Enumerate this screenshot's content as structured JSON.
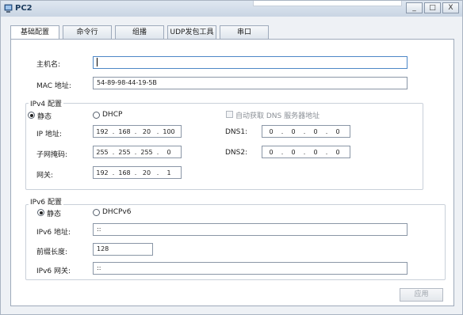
{
  "window": {
    "title": "PC2",
    "buttons": {
      "minimize": "_",
      "maximize": "□",
      "close": "X"
    }
  },
  "tabs": [
    {
      "label": "基础配置",
      "active": true
    },
    {
      "label": "命令行",
      "active": false
    },
    {
      "label": "组播",
      "active": false
    },
    {
      "label": "UDP发包工具",
      "active": false
    },
    {
      "label": "串口",
      "active": false
    }
  ],
  "basic": {
    "hostname_label": "主机名:",
    "hostname_value": "",
    "mac_label": "MAC 地址:",
    "mac_value": "54-89-98-44-19-5B"
  },
  "ipv4": {
    "group_title": "IPv4 配置",
    "static_label": "静态",
    "static_selected": true,
    "dhcp_label": "DHCP",
    "auto_dns_label": "自动获取 DNS 服务器地址",
    "ip_label": "IP 地址:",
    "ip": [
      "192",
      "168",
      "20",
      "100"
    ],
    "mask_label": "子网掩码:",
    "mask": [
      "255",
      "255",
      "255",
      "0"
    ],
    "gateway_label": "网关:",
    "gateway": [
      "192",
      "168",
      "20",
      "1"
    ],
    "dns1_label": "DNS1:",
    "dns1": [
      "0",
      "0",
      "0",
      "0"
    ],
    "dns2_label": "DNS2:",
    "dns2": [
      "0",
      "0",
      "0",
      "0"
    ]
  },
  "ipv6": {
    "group_title": "IPv6 配置",
    "static_label": "静态",
    "static_selected": true,
    "dhcp_label": "DHCPv6",
    "addr_label": "IPv6 地址:",
    "addr_value": "::",
    "prefix_label": "前缀长度:",
    "prefix_value": "128",
    "gateway_label": "IPv6 网关:",
    "gateway_value": "::"
  },
  "apply_label": "应用"
}
